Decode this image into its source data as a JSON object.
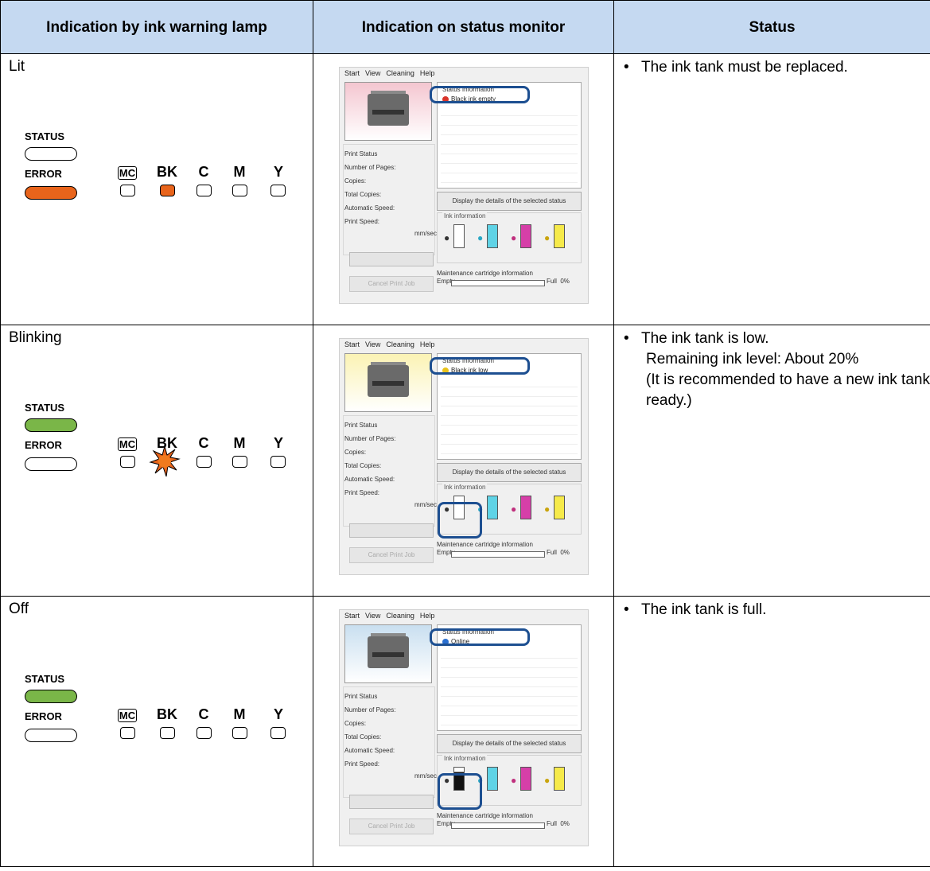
{
  "headers": {
    "col1": "Indication by ink warning lamp",
    "col2": "Indication on status monitor",
    "col3": "Status"
  },
  "lamp_labels": {
    "status": "STATUS",
    "error": "ERROR",
    "mc": "MC",
    "bk": "BK",
    "c": "C",
    "m": "M",
    "y": "Y"
  },
  "monitor": {
    "menu": [
      "Start",
      "View",
      "Cleaning",
      "Help"
    ],
    "status_information": "Status Information",
    "fields": [
      "Print Status",
      "Number of Pages:",
      "Copies:",
      "Total Copies:",
      "Automatic Speed:",
      "Print Speed:"
    ],
    "mm_sec": "mm/sec",
    "details_button": "Display the details of the selected status",
    "ink_information": "Ink information",
    "cancel_button": "Cancel Print Job",
    "maintenance": "Maintenance cartridge information",
    "empty": "Empty",
    "full": "Full",
    "percent": "0%"
  },
  "rows": [
    {
      "state": "Lit",
      "status_led": "off",
      "error_led": "orange",
      "bk_led": "lit",
      "monitor_message": "Black ink empty",
      "message_icon_color": "#d9342b",
      "printer_bg": "#f4c6d0",
      "status_lines": [
        "The ink tank must be replaced."
      ]
    },
    {
      "state": "Blinking",
      "status_led": "green",
      "error_led": "off",
      "bk_led": "blinking",
      "monitor_message": "Black ink low",
      "message_icon_color": "#e8c21b",
      "printer_bg": "#fbf3b4",
      "status_lines": [
        "The ink tank is low.",
        "Remaining ink level: About 20%",
        "(It is recommended to have a new ink tank ready.)"
      ]
    },
    {
      "state": "Off",
      "status_led": "green",
      "error_led": "off",
      "bk_led": "off",
      "monitor_message": "Online",
      "message_icon_color": "#2a6fd1",
      "printer_bg": "#c9dff0",
      "status_lines": [
        "The ink tank is full."
      ]
    }
  ],
  "colors": {
    "header_bg": "#c5d9f1",
    "lamp_orange": "#e8641b",
    "lamp_green": "#7ab648",
    "callout_blue": "#1d4f91"
  }
}
